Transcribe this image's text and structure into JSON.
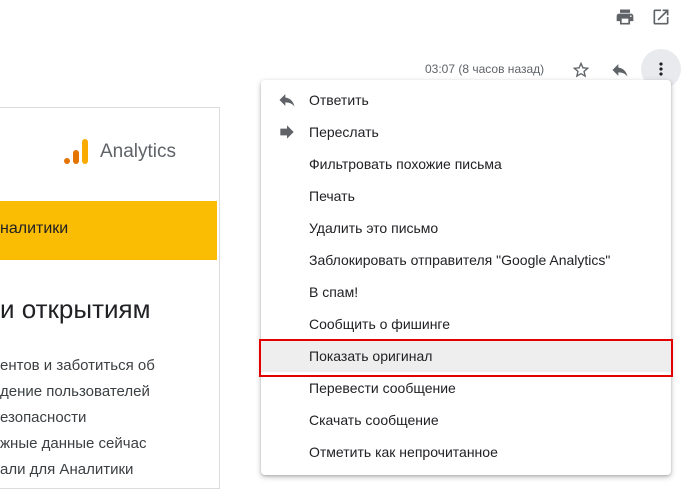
{
  "header": {
    "print_icon": "print-icon",
    "open_icon": "open-in-new-window-icon"
  },
  "message": {
    "timestamp": "03:07 (8 часов назад)"
  },
  "email": {
    "logo_text": "Analytics",
    "banner_text": "налитики",
    "heading": "и открытиям",
    "lines": [
      "ентов и заботиться об",
      "дение пользователей",
      "езопасности",
      "жные данные сейчас",
      "али для Аналитики"
    ],
    "colors": {
      "banner": "#fbbc04",
      "logo_orange": "#f9ab00",
      "logo_dark": "#e37400"
    }
  },
  "menu": {
    "items": [
      {
        "label": "Ответить",
        "icon": "reply-icon"
      },
      {
        "label": "Переслать",
        "icon": "forward-icon"
      },
      {
        "label": "Фильтровать похожие письма"
      },
      {
        "label": "Печать"
      },
      {
        "label": "Удалить это письмо"
      },
      {
        "label": "Заблокировать отправителя \"Google Analytics\""
      },
      {
        "label": "В спам!"
      },
      {
        "label": "Сообщить о фишинге"
      },
      {
        "label": "Показать оригинал",
        "highlighted": true
      },
      {
        "label": "Перевести сообщение"
      },
      {
        "label": "Скачать сообщение"
      },
      {
        "label": "Отметить как непрочитанное"
      }
    ],
    "highlight_color": "#e30000"
  }
}
